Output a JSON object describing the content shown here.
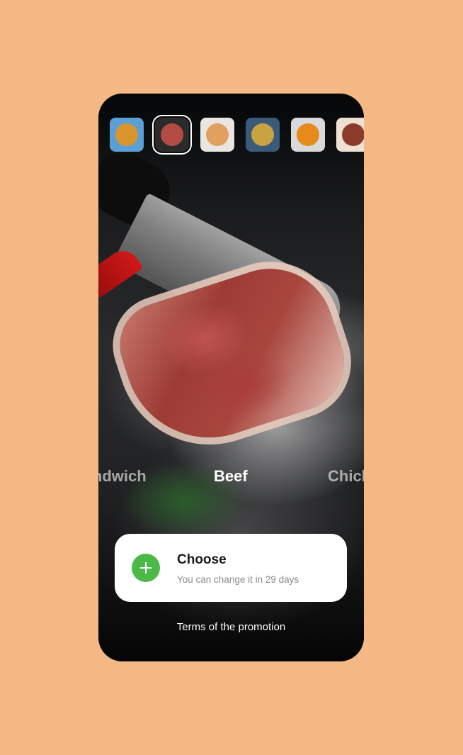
{
  "colors": {
    "page_background": "#F4B885",
    "phone_background": "#0B0C0D",
    "accent_green": "#4CB847",
    "card_background": "#FFFFFF"
  },
  "thumbnails": [
    {
      "icon": "sandwich-thumbnail",
      "bg": "#5a9fd6",
      "dish": "#d9952e",
      "selected": false
    },
    {
      "icon": "beef-thumbnail",
      "bg": "#2b2b2b",
      "dish": "#b44a44",
      "selected": true
    },
    {
      "icon": "soup-bowl-thumbnail",
      "bg": "#e9e6e2",
      "dish": "#e0a060",
      "selected": false
    },
    {
      "icon": "salad-thumbnail",
      "bg": "#3a5a7a",
      "dish": "#c9a341",
      "selected": false
    },
    {
      "icon": "pumpkin-soup-thumbnail",
      "bg": "#d9d9d9",
      "dish": "#e68a1c",
      "selected": false
    },
    {
      "icon": "pizza-thumbnail",
      "bg": "#efe1d2",
      "dish": "#8b3b2a",
      "selected": false
    }
  ],
  "carousel": {
    "previous": "Sandwich",
    "current": "Beef",
    "next": "Chicken"
  },
  "card": {
    "title": "Choose",
    "subtitle": "You can change it in 29 days"
  },
  "terms_link": "Terms of the promotion"
}
